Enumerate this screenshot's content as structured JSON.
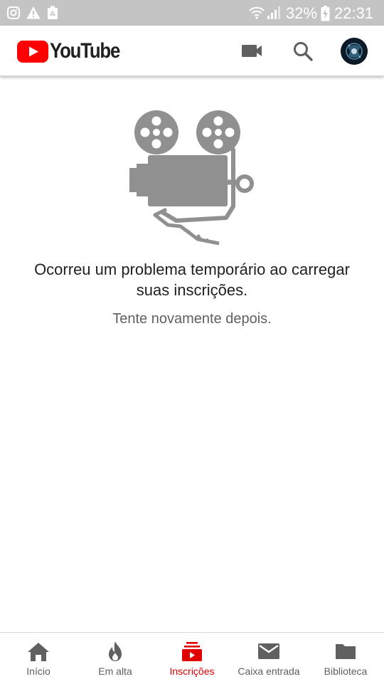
{
  "colors": {
    "brand_red": "#ff0000",
    "active_tab": "#e00000",
    "icon_gray": "#606060",
    "illustration_gray": "#909090",
    "status_bar": "#c4c4c4"
  },
  "status_bar": {
    "left_icons": [
      "instagram-icon",
      "warning-icon",
      "recycle-icon"
    ],
    "battery_percent": "32%",
    "time": "22:31"
  },
  "header": {
    "logo_text": "YouTube",
    "actions": [
      "video-camera-icon",
      "search-icon",
      "avatar"
    ]
  },
  "main": {
    "illustration": "film-projector-icon",
    "error_title": "Ocorreu um problema temporário ao carregar suas inscrições.",
    "error_subtitle": "Tente novamente depois."
  },
  "bottom_nav": {
    "active": "inscricoes",
    "items": [
      {
        "id": "inicio",
        "label": "Início",
        "icon": "home-icon"
      },
      {
        "id": "em-alta",
        "label": "Em alta",
        "icon": "flame-icon"
      },
      {
        "id": "inscricoes",
        "label": "Inscrições",
        "icon": "subscriptions-icon"
      },
      {
        "id": "caixa-entrada",
        "label": "Caixa entrada",
        "icon": "mail-icon"
      },
      {
        "id": "biblioteca",
        "label": "Biblioteca",
        "icon": "folder-icon"
      }
    ]
  }
}
